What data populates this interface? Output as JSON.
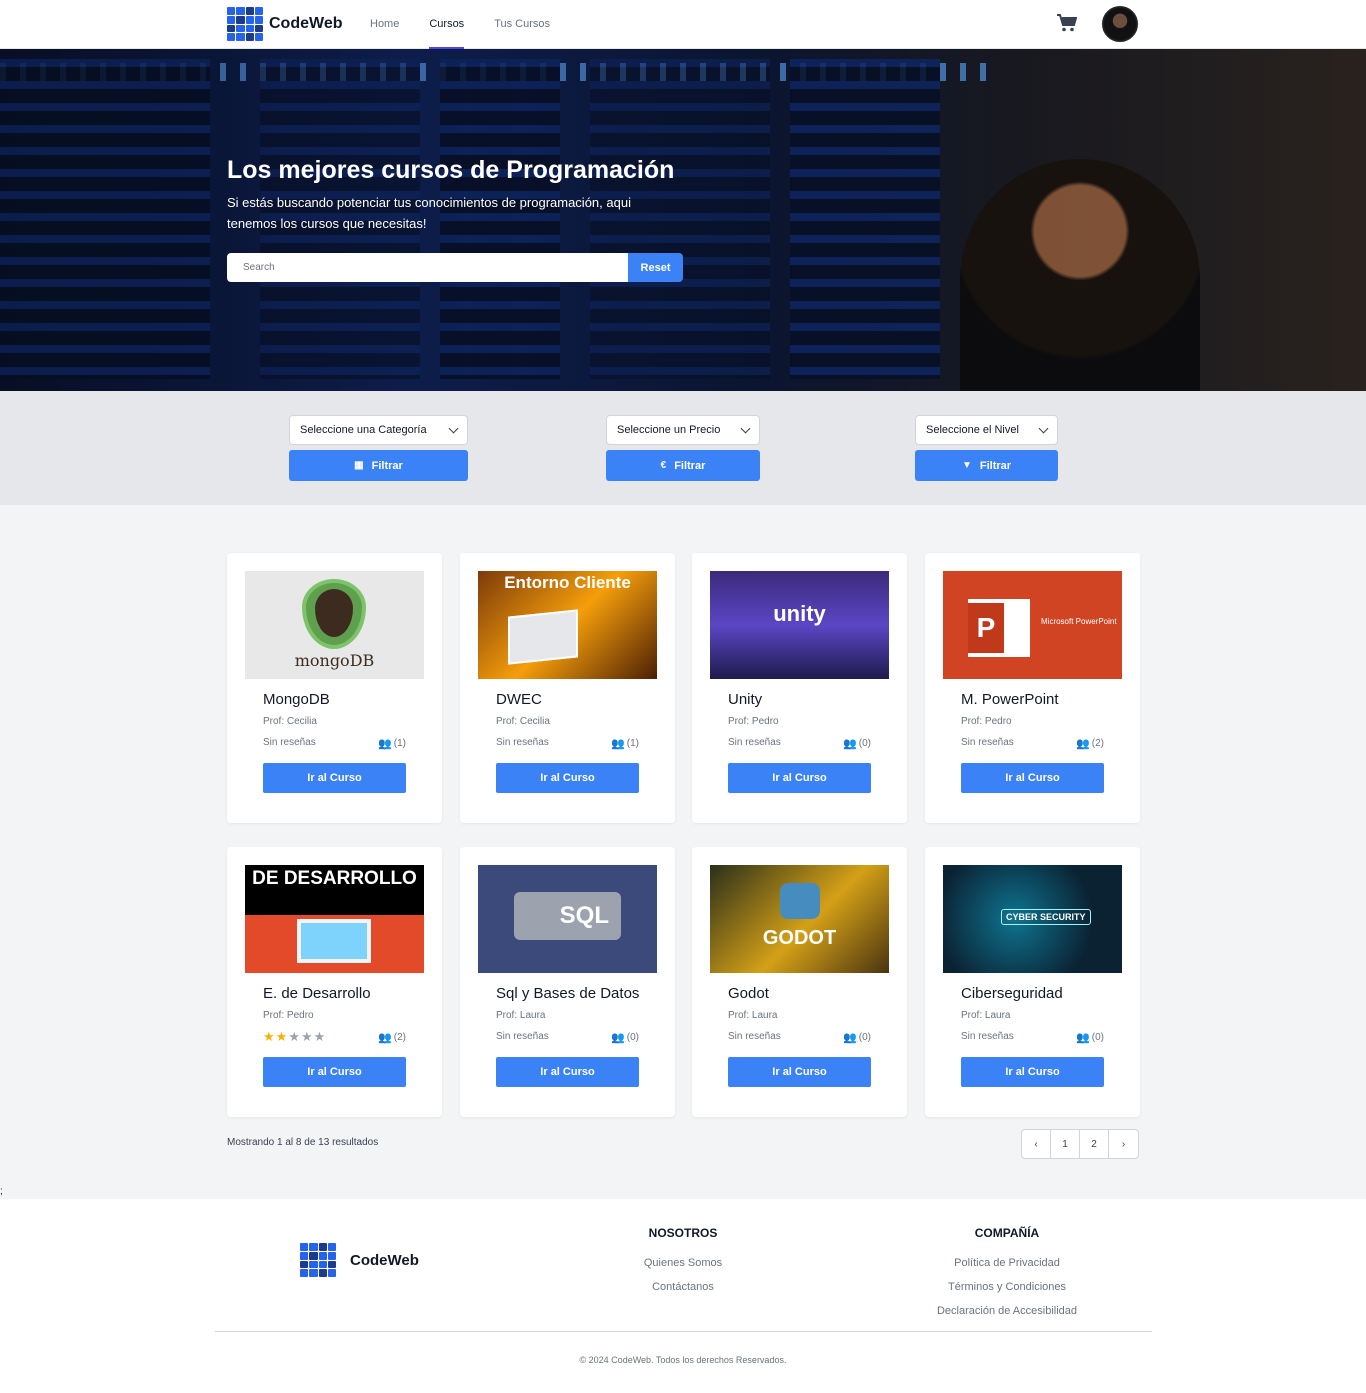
{
  "brand": {
    "name": "CodeWeb"
  },
  "nav": {
    "links": [
      {
        "label": "Home"
      },
      {
        "label": "Cursos"
      },
      {
        "label": "Tus Cursos"
      }
    ],
    "cart_icon": "cart-icon"
  },
  "hero": {
    "title": "Los mejores cursos de Programación",
    "subtitle": "Si estás buscando potenciar tus conocimientos de programación, aqui tenemos los cursos que necesitas!",
    "search_placeholder": "Search",
    "reset_label": "Reset"
  },
  "filters": [
    {
      "select": "Seleccione una Categoría",
      "button": "Filtrar",
      "icon": "grid-icon"
    },
    {
      "select": "Seleccione un Precio",
      "button": "Filtrar",
      "icon": "euro-icon"
    },
    {
      "select": "Seleccione el Nivel",
      "button": "Filtrar",
      "icon": "funnel-icon"
    }
  ],
  "courses": [
    {
      "title": "MongoDB",
      "prof": "Prof: Cecilia",
      "reviews": "Sin reseñas",
      "students": "(1)",
      "button": "Ir al Curso",
      "thumb_text": "mongoDB"
    },
    {
      "title": "DWEC",
      "prof": "Prof: Cecilia",
      "reviews": "Sin reseñas",
      "students": "(1)",
      "button": "Ir al Curso",
      "thumb_text": "Entorno Cliente"
    },
    {
      "title": "Unity",
      "prof": "Prof: Pedro",
      "reviews": "Sin reseñas",
      "students": "(0)",
      "button": "Ir al Curso",
      "thumb_text": "unity"
    },
    {
      "title": "M. PowerPoint",
      "prof": "Prof: Pedro",
      "reviews": "Sin reseñas",
      "students": "(2)",
      "button": "Ir al Curso",
      "thumb_text": "Microsoft PowerPoint"
    },
    {
      "title": "E. de Desarrollo",
      "prof": "Prof: Pedro",
      "rating": 2,
      "rating_max": 5,
      "students": "(2)",
      "button": "Ir al Curso",
      "thumb_text": "DE DESARROLLO"
    },
    {
      "title": "Sql y Bases de Datos",
      "prof": "Prof: Laura",
      "reviews": "Sin reseñas",
      "students": "(0)",
      "button": "Ir al Curso",
      "thumb_text": "SQL"
    },
    {
      "title": "Godot",
      "prof": "Prof: Laura",
      "reviews": "Sin reseñas",
      "students": "(0)",
      "button": "Ir al Curso",
      "thumb_text": "GODOT"
    },
    {
      "title": "Ciberseguridad",
      "prof": "Prof: Laura",
      "reviews": "Sin reseñas",
      "students": "(0)",
      "button": "Ir al Curso",
      "thumb_text": "CYBER SECURITY"
    }
  ],
  "pagination": {
    "summary": "Mostrando 1 al 8 de 13 resultados",
    "pages": [
      "1",
      "2"
    ],
    "prev": "‹",
    "next": "›"
  },
  "stray_text": ";",
  "footer": {
    "brand": "CodeWeb",
    "col1": {
      "title": "NOSOTROS",
      "links": [
        "Quienes Somos",
        "Contáctanos"
      ]
    },
    "col2": {
      "title": "COMPAÑÍA",
      "links": [
        "Política de Privacidad",
        "Términos y Condiciones",
        "Declaración de Accesibilidad"
      ]
    },
    "copyright": "© 2024 CodeWeb. Todos los derechos Reservados."
  },
  "colors": {
    "primary": "#3b82f6",
    "star": "#f5b301",
    "filters_bg": "#e5e7eb"
  }
}
